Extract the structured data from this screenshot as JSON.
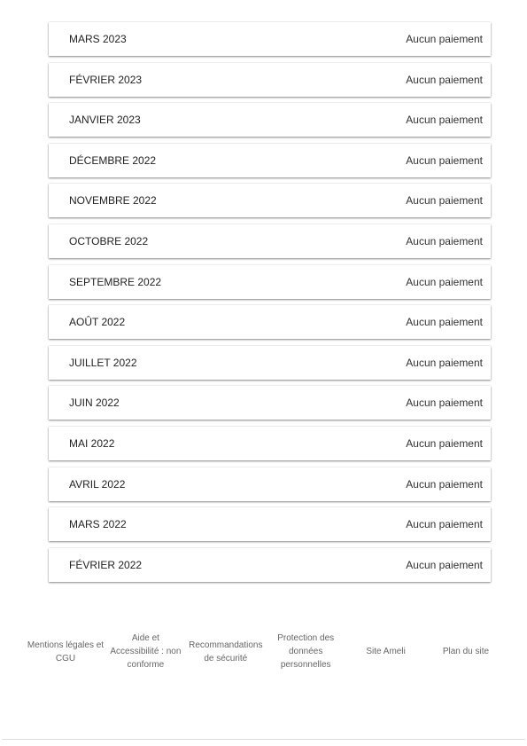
{
  "payments": [
    {
      "month": "MARS 2023",
      "status": "Aucun paiement"
    },
    {
      "month": "FÉVRIER 2023",
      "status": "Aucun paiement"
    },
    {
      "month": "JANVIER 2023",
      "status": "Aucun paiement"
    },
    {
      "month": "DÉCEMBRE 2022",
      "status": "Aucun paiement"
    },
    {
      "month": "NOVEMBRE 2022",
      "status": "Aucun paiement"
    },
    {
      "month": "OCTOBRE 2022",
      "status": "Aucun paiement"
    },
    {
      "month": "SEPTEMBRE 2022",
      "status": "Aucun paiement"
    },
    {
      "month": "AOÛT 2022",
      "status": "Aucun paiement"
    },
    {
      "month": "JUILLET 2022",
      "status": "Aucun paiement"
    },
    {
      "month": "JUIN 2022",
      "status": "Aucun paiement"
    },
    {
      "month": "MAI 2022",
      "status": "Aucun paiement"
    },
    {
      "month": "AVRIL 2022",
      "status": "Aucun paiement"
    },
    {
      "month": "MARS 2022",
      "status": "Aucun paiement"
    },
    {
      "month": "FÉVRIER 2022",
      "status": "Aucun paiement"
    }
  ],
  "footer": {
    "links": [
      "Mentions légales et CGU",
      "Aide et Accessibilité : non conforme",
      "Recommandations de sécurité",
      "Protection des données personnelles",
      "Site Ameli",
      "Plan du site"
    ]
  }
}
